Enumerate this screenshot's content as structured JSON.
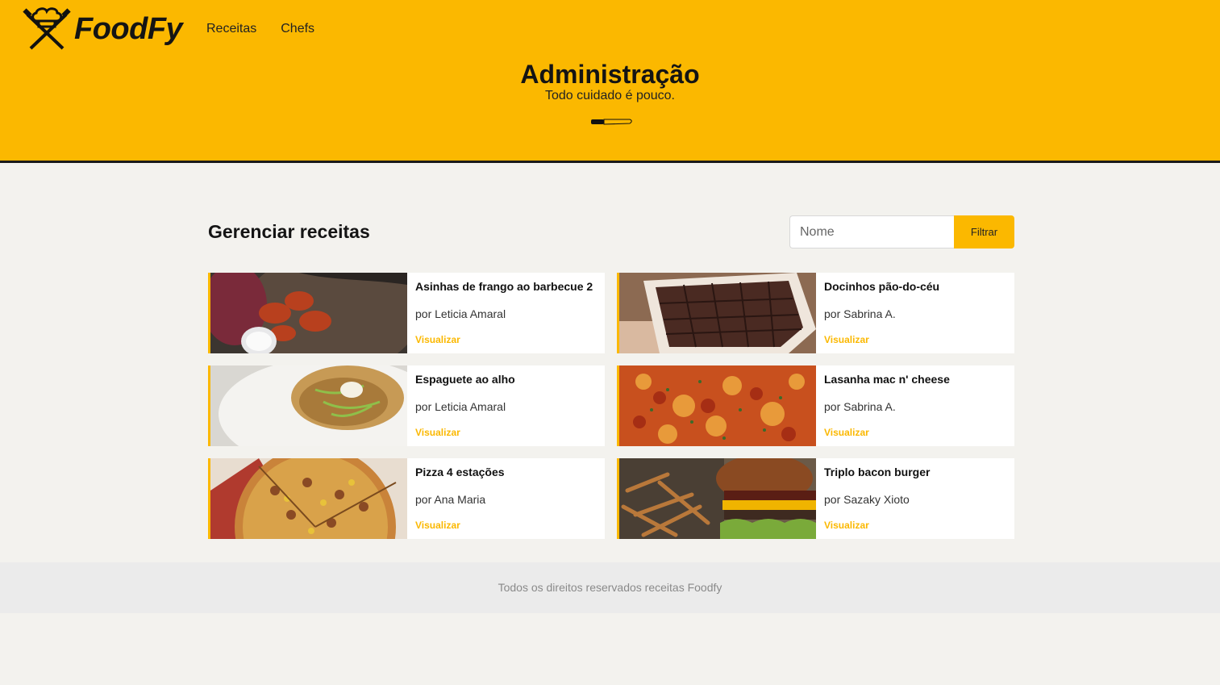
{
  "brand": {
    "name": "FoodFy"
  },
  "nav": {
    "items": [
      "Receitas",
      "Chefs"
    ]
  },
  "hero": {
    "title": "Administração",
    "subtitle": "Todo cuidado é pouco."
  },
  "main": {
    "title": "Gerenciar receitas",
    "filter": {
      "placeholder": "Nome",
      "value": "",
      "button_label": "Filtrar"
    }
  },
  "recipes": [
    {
      "title": "Asinhas de frango ao barbecue 2",
      "author": "por Leticia Amaral",
      "link": "Visualizar",
      "thumb": "chicken-wings"
    },
    {
      "title": "Docinhos pão-do-céu",
      "author": "por Sabrina A.",
      "link": "Visualizar",
      "thumb": "chocolate-box"
    },
    {
      "title": "Espaguete ao alho",
      "author": "por Leticia Amaral",
      "link": "Visualizar",
      "thumb": "spaghetti"
    },
    {
      "title": "Lasanha mac n' cheese",
      "author": "por Sabrina A.",
      "link": "Visualizar",
      "thumb": "lasagna"
    },
    {
      "title": "Pizza 4 estações",
      "author": "por Ana Maria",
      "link": "Visualizar",
      "thumb": "pizza"
    },
    {
      "title": "Triplo bacon burger",
      "author": "por Sazaky Xioto",
      "link": "Visualizar",
      "thumb": "burger"
    }
  ],
  "footer": {
    "text": "Todos os direitos reservados receitas Foodfy"
  },
  "colors": {
    "accent": "#fbb800",
    "background": "#f3f2ee",
    "footer": "#ebebeb",
    "dark": "#1a1a1a"
  }
}
